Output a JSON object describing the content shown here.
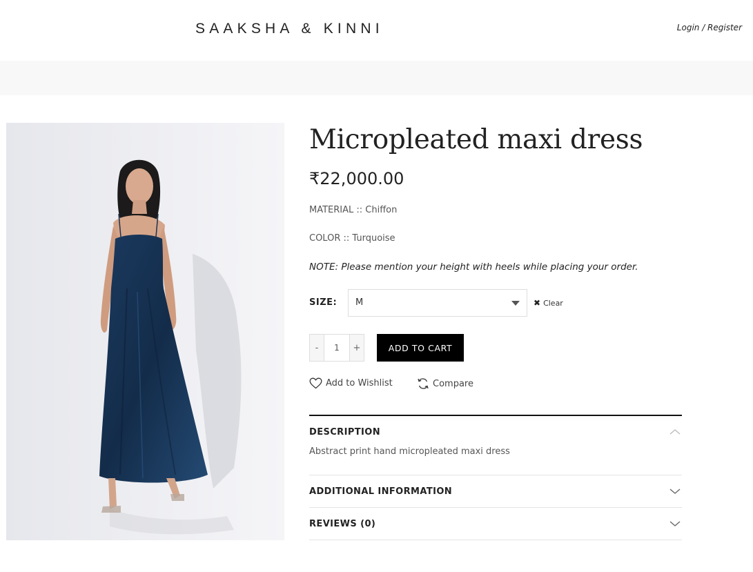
{
  "header": {
    "logo_text": "SAAKSHA & KINNI",
    "login_register": "Login / Register"
  },
  "product": {
    "title": "Micropleated maxi dress",
    "price": "₹22,000.00",
    "material": "MATERIAL :: Chiffon",
    "color": "COLOR :: Turquoise",
    "note": "NOTE: Please mention your height with heels while placing your order.",
    "size_label": "SIZE",
    "size_selected": "M",
    "clear_label": "Clear",
    "qty_minus": "-",
    "qty_value": "1",
    "qty_plus": "+",
    "add_to_cart": "ADD TO CART",
    "wishlist": "Add to Wishlist",
    "compare": "Compare"
  },
  "tabs": [
    {
      "label": "DESCRIPTION",
      "expanded": true,
      "content": "Abstract print hand micropleated maxi dress"
    },
    {
      "label": "ADDITIONAL INFORMATION",
      "expanded": false
    },
    {
      "label": "REVIEWS (0)",
      "expanded": false
    }
  ],
  "colors": {
    "accent_button": "#000000",
    "text_dark": "#222222",
    "band_background": "#f8f8f8",
    "dress_color": "#1f3d62"
  },
  "icons": {
    "wishlist": "heart-icon",
    "compare": "refresh-icon",
    "clear": "close-icon",
    "size_dropdown": "caret-down-icon",
    "accordion_open": "chevron-up-icon",
    "accordion_closed": "chevron-down-icon"
  }
}
